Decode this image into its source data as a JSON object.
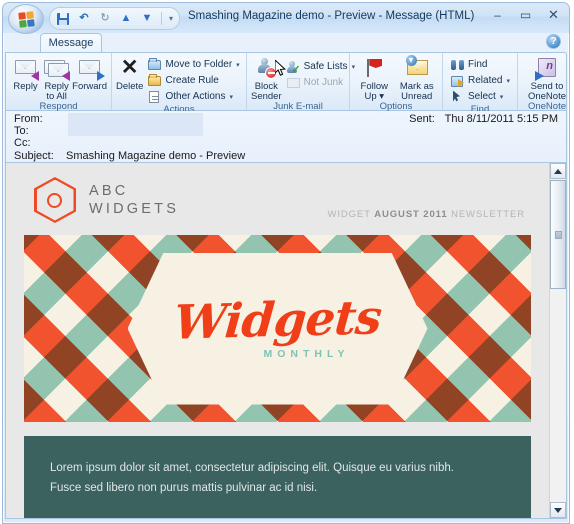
{
  "window": {
    "title": "Smashing Magazine demo - Preview - Message (HTML)",
    "minimize_label": "–",
    "maximize_label": "▭",
    "close_label": "✕",
    "help_label": "?"
  },
  "quick_access": {
    "items": [
      {
        "name": "office-orb",
        "label": "Office"
      },
      {
        "name": "save-icon",
        "label": "Save"
      },
      {
        "name": "undo-icon",
        "label": "Undo",
        "glyph": "↶"
      },
      {
        "name": "redo-icon",
        "label": "Redo",
        "glyph": "↻"
      },
      {
        "name": "previous-item-icon",
        "label": "Previous Item",
        "glyph": "▲"
      },
      {
        "name": "next-item-icon",
        "label": "Next Item",
        "glyph": "▼"
      },
      {
        "name": "customize-qat-icon",
        "label": "Customize Quick Access Toolbar",
        "glyph": "▾"
      }
    ]
  },
  "ribbon": {
    "tab": "Message",
    "groups": [
      {
        "label": "Respond",
        "has_dialog_launcher": false,
        "buttons": [
          {
            "label": "Reply",
            "icon": "reply-icon"
          },
          {
            "label": "Reply\nto All",
            "line1": "Reply",
            "line2": "to All",
            "icon": "reply-all-icon"
          },
          {
            "label": "Forward",
            "icon": "forward-icon"
          }
        ]
      },
      {
        "label": "Actions",
        "has_dialog_launcher": false,
        "big": [
          {
            "label": "Delete",
            "icon": "delete-icon"
          }
        ],
        "small": [
          {
            "label": "Move to Folder",
            "icon": "move-to-folder-icon",
            "caret": true,
            "disabled": false
          },
          {
            "label": "Create Rule",
            "icon": "create-rule-icon",
            "caret": false,
            "disabled": false
          },
          {
            "label": "Other Actions",
            "icon": "other-actions-icon",
            "caret": true,
            "disabled": false
          }
        ]
      },
      {
        "label": "Junk E-mail",
        "has_dialog_launcher": true,
        "big": [
          {
            "line1": "Block",
            "line2": "Sender",
            "icon": "block-sender-icon"
          }
        ],
        "small": [
          {
            "label": "Safe Lists",
            "icon": "safe-lists-icon",
            "caret": true,
            "disabled": false
          },
          {
            "label": "Not Junk",
            "icon": "not-junk-icon",
            "caret": false,
            "disabled": true
          }
        ]
      },
      {
        "label": "Options",
        "has_dialog_launcher": true,
        "buttons": [
          {
            "line1": "Follow",
            "line2": "Up",
            "icon": "follow-up-icon",
            "caret": true
          },
          {
            "line1": "Mark as",
            "line2": "Unread",
            "icon": "mark-as-unread-icon",
            "caret": false
          }
        ]
      },
      {
        "label": "Find",
        "has_dialog_launcher": false,
        "small": [
          {
            "label": "Find",
            "icon": "find-icon",
            "caret": false,
            "disabled": false
          },
          {
            "label": "Related",
            "icon": "related-icon",
            "caret": true,
            "disabled": false
          },
          {
            "label": "Select",
            "icon": "select-icon",
            "caret": true,
            "disabled": false
          }
        ]
      },
      {
        "label": "OneNote",
        "has_dialog_launcher": false,
        "buttons": [
          {
            "line1": "Send to",
            "line2": "OneNote",
            "icon": "send-to-onenote-icon"
          }
        ]
      }
    ],
    "dialog_launcher_glyph": "⤷"
  },
  "header_fields": {
    "from_label": "From:",
    "from_value": "",
    "to_label": "To:",
    "to_value": "",
    "cc_label": "Cc:",
    "cc_value": "",
    "subject_label": "Subject:",
    "subject_value": "Smashing Magazine demo - Preview",
    "sent_label": "Sent:",
    "sent_value": "Thu 8/11/2011 5:15 PM"
  },
  "email": {
    "brand": {
      "line1": "ABC",
      "line2": "WIDGETS",
      "logo_icon": "hexagon-logo-icon",
      "accent_color": "#ef4a23"
    },
    "newsletter_prefix": "WIDGET",
    "newsletter_date": "AUGUST 2011",
    "newsletter_suffix": "NEWSLETTER",
    "banner": {
      "title": "Widgets",
      "subtitle": "MONTHLY",
      "pattern": "plaid-diagonal",
      "colors": {
        "red": "#f03d16",
        "brown": "#8b2408",
        "mint": "#9ed3c6",
        "cream": "#f7f1e4",
        "title_color": "#ef3e18",
        "subtitle_color": "#7ec4b6"
      }
    },
    "body_text_line1": "Lorem ipsum dolor sit amet, consectetur adipiscing elit. Quisque eu varius nibh.",
    "body_text_line2": "Fusce sed libero non purus mattis pulvinar ac id nisi.",
    "body_bg": "#3c6260"
  },
  "scrollbar": {
    "up_label": "Scroll up",
    "down_label": "Scroll down",
    "thumb_label": "Scroll thumb"
  }
}
